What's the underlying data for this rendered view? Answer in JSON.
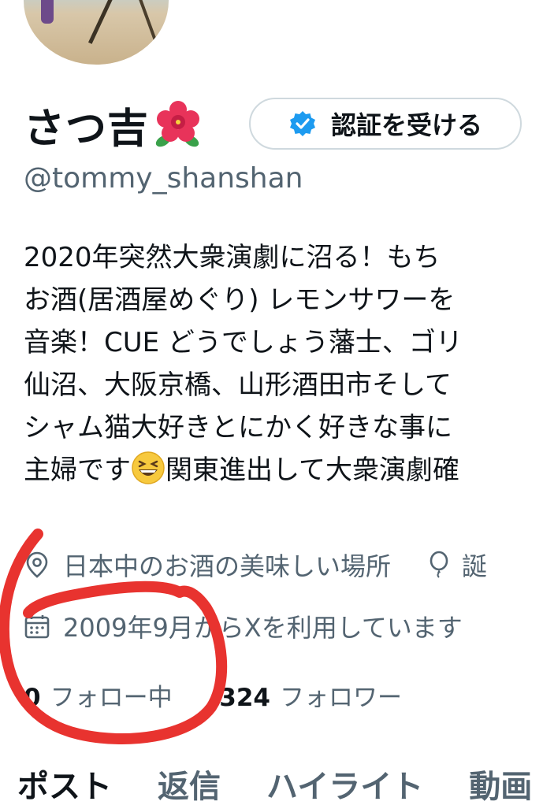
{
  "profile": {
    "display_name": "さつ吉",
    "name_emoji": "hibiscus-emoji",
    "verify_button_label": "認証を受ける",
    "handle": "@tommy_shanshan"
  },
  "bio": {
    "lines": [
      "2020年突然大衆演劇に沼る！もち",
      "お酒(居酒屋めぐり) レモンサワーを",
      "音楽！CUE どうでしょう藩士、ゴリ",
      "仙沼、大阪京橋、山形酒田市そして",
      "シャム猫大好きとにかく好きな事に",
      "主婦です",
      "関東進出して大衆演劇確"
    ]
  },
  "meta": {
    "location": "日本中のお酒の美味しい場所",
    "birthday_partial": "誕",
    "joined": "2009年9月からXを利用しています"
  },
  "stats": {
    "following_count": "0",
    "following_label": "フォロー中",
    "followers_count": "324",
    "followers_label": "フォロワー"
  },
  "tabs": [
    "ポスト",
    "返信",
    "ハイライト",
    "動画"
  ],
  "colors": {
    "text_primary": "#0f1419",
    "text_secondary": "#536471",
    "verify_blue": "#1d9bf0",
    "annotation_red": "#e8332f"
  }
}
